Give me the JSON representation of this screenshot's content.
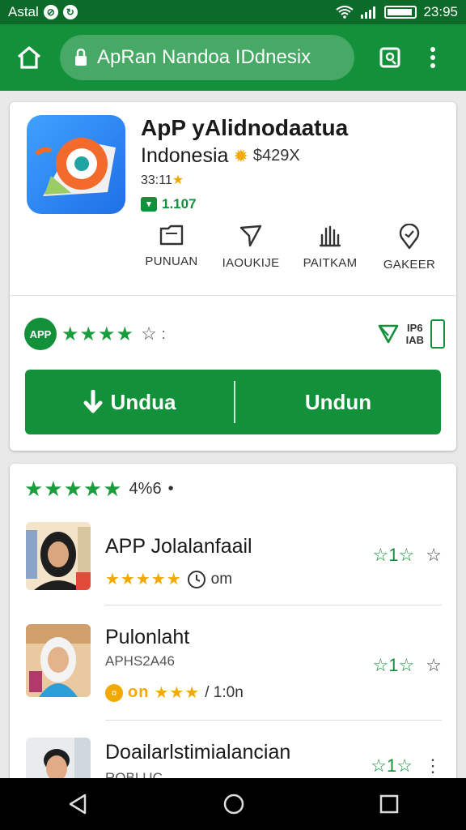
{
  "status_bar": {
    "carrier": "Astal",
    "time": "23:95"
  },
  "app_bar": {
    "url_text": "ApRan Nandoa IDdnesix"
  },
  "app": {
    "title": "ApP yAlidnodaatua",
    "subtitle": "Indonesia",
    "price": "$429X",
    "rating_small": "33:11",
    "downloads": "1.107",
    "actions": [
      {
        "label": "PUNUAN",
        "icon": "folder-icon"
      },
      {
        "label": "IAOUKIJE",
        "icon": "send-icon"
      },
      {
        "label": "PAITKAM",
        "icon": "hand-icon"
      },
      {
        "label": "GAKEER",
        "icon": "location-pin-icon"
      }
    ],
    "badge_text": "APP",
    "size_top": "IP6",
    "size_bottom": "IAB",
    "install_left": "Undua",
    "install_right": "Undun"
  },
  "reviews": {
    "score": "4%6",
    "items": [
      {
        "name": "APP Jolalanfaail",
        "meta": "om",
        "actions": "1"
      },
      {
        "name": "Pulonlaht",
        "sub": "APHS2A46",
        "meta_prefix": "on",
        "meta": "/ 1:0n",
        "actions": "1"
      },
      {
        "name": "Doailarlstimialancian",
        "sub": "ROBLUC",
        "actions": "1"
      }
    ]
  },
  "colors": {
    "primary": "#12913a",
    "status": "#0d6b2a",
    "star_gold": "#f2a900"
  }
}
